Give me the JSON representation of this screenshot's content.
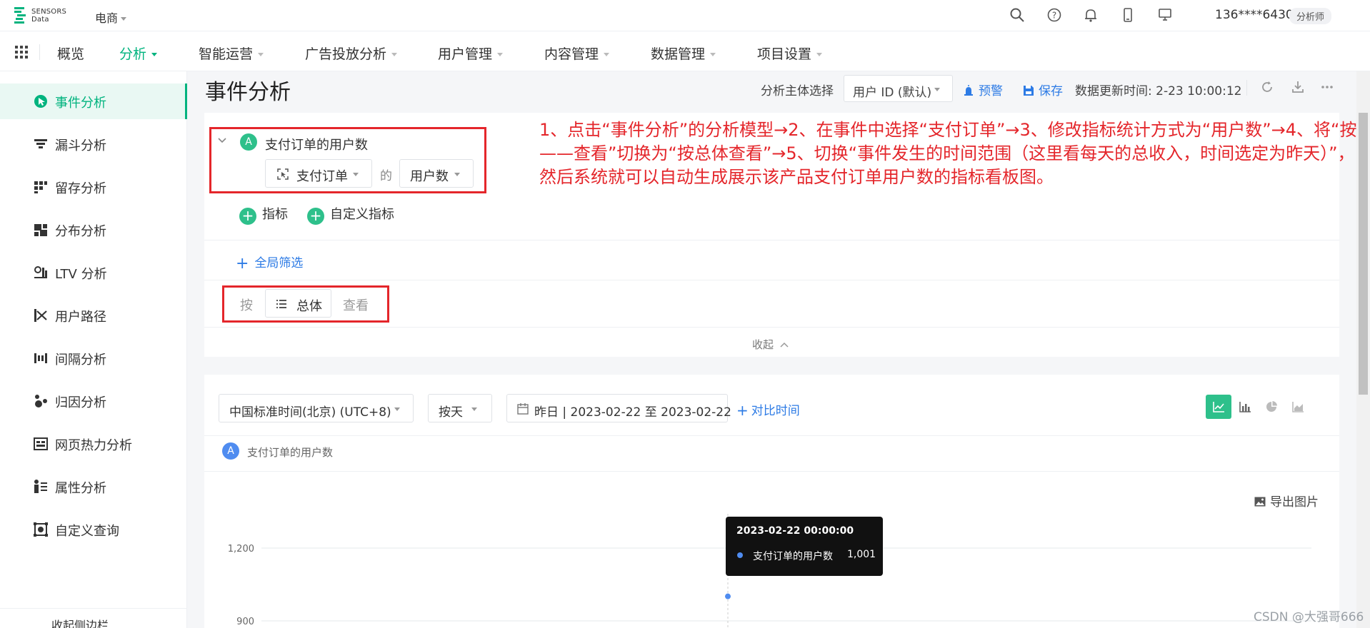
{
  "app": {
    "logo_line1": "SENSORS",
    "logo_line2": "Data",
    "project": "电商",
    "account": "136****6430",
    "role": "分析师"
  },
  "nav": {
    "items": [
      {
        "label": "概览",
        "dropdown": false,
        "active": false
      },
      {
        "label": "分析",
        "dropdown": true,
        "active": true
      },
      {
        "label": "智能运营",
        "dropdown": true,
        "active": false
      },
      {
        "label": "广告投放分析",
        "dropdown": true,
        "active": false
      },
      {
        "label": "用户管理",
        "dropdown": true,
        "active": false
      },
      {
        "label": "内容管理",
        "dropdown": true,
        "active": false
      },
      {
        "label": "数据管理",
        "dropdown": true,
        "active": false
      },
      {
        "label": "项目设置",
        "dropdown": true,
        "active": false
      }
    ]
  },
  "sidebar": {
    "items": [
      {
        "label": "事件分析",
        "icon": "cursor-click-icon",
        "active": true
      },
      {
        "label": "漏斗分析",
        "icon": "funnel-icon",
        "active": false
      },
      {
        "label": "留存分析",
        "icon": "retention-icon",
        "active": false
      },
      {
        "label": "分布分析",
        "icon": "distribution-icon",
        "active": false
      },
      {
        "label": "LTV 分析",
        "icon": "ltv-icon",
        "active": false
      },
      {
        "label": "用户路径",
        "icon": "user-path-icon",
        "active": false
      },
      {
        "label": "间隔分析",
        "icon": "interval-icon",
        "active": false
      },
      {
        "label": "归因分析",
        "icon": "attribution-icon",
        "active": false
      },
      {
        "label": "网页热力分析",
        "icon": "heatmap-icon",
        "active": false
      },
      {
        "label": "属性分析",
        "icon": "attribute-icon",
        "active": false
      },
      {
        "label": "自定义查询",
        "icon": "custom-query-icon",
        "active": false
      }
    ],
    "collapse_label": "收起侧边栏"
  },
  "header": {
    "title": "事件分析",
    "subject_label": "分析主体选择",
    "subject_value": "用户 ID (默认)",
    "alert_label": "预警",
    "save_label": "保存",
    "update_time": "数据更新时间: 2-23 10:00:12"
  },
  "query": {
    "metric_badge": "A",
    "metric_name": "支付订单的用户数",
    "event": "支付订单",
    "of_text": "的",
    "stat": "用户数",
    "add_metric": "指标",
    "add_custom_metric": "自定义指标",
    "global_filter": "全局筛选",
    "groupby_prefix": "按",
    "groupby_value": "总体",
    "groupby_suffix": "查看",
    "collapse": "收起"
  },
  "annotation": "1、点击“事件分析”的分析模型→2、在事件中选择“支付订单”→3、修改指标统计方式为“用户数”→4、将“按——查看”切换为“按总体查看”→5、切换“事件发生的时间范围（这里看每天的总收入，时间选定为昨天）”，然后系统就可以自动生成展示该产品支付订单用户数的指标看板图。",
  "result": {
    "timezone": "中国标准时间(北京) (UTC+8)",
    "granularity": "按天",
    "date_range": "昨日 | 2023-02-22 至 2023-02-22",
    "compare": "对比时间",
    "series_badge": "A",
    "series_name": "支付订单的用户数",
    "export": "导出图片"
  },
  "chart_data": {
    "type": "line",
    "x": [
      "2023-02-22"
    ],
    "series": [
      {
        "name": "支付订单的用户数",
        "values": [
          1001
        ]
      }
    ],
    "y_ticks": [
      "1,200",
      "900"
    ],
    "tooltip": {
      "time": "2023-02-22 00:00:00",
      "name": "支付订单的用户数",
      "value": "1,001"
    }
  },
  "watermark": "CSDN @大强哥666",
  "colors": {
    "accent": "#00b37e",
    "link": "#2d7be5",
    "annotation": "#e4262b",
    "series": "#4f8cf0"
  }
}
